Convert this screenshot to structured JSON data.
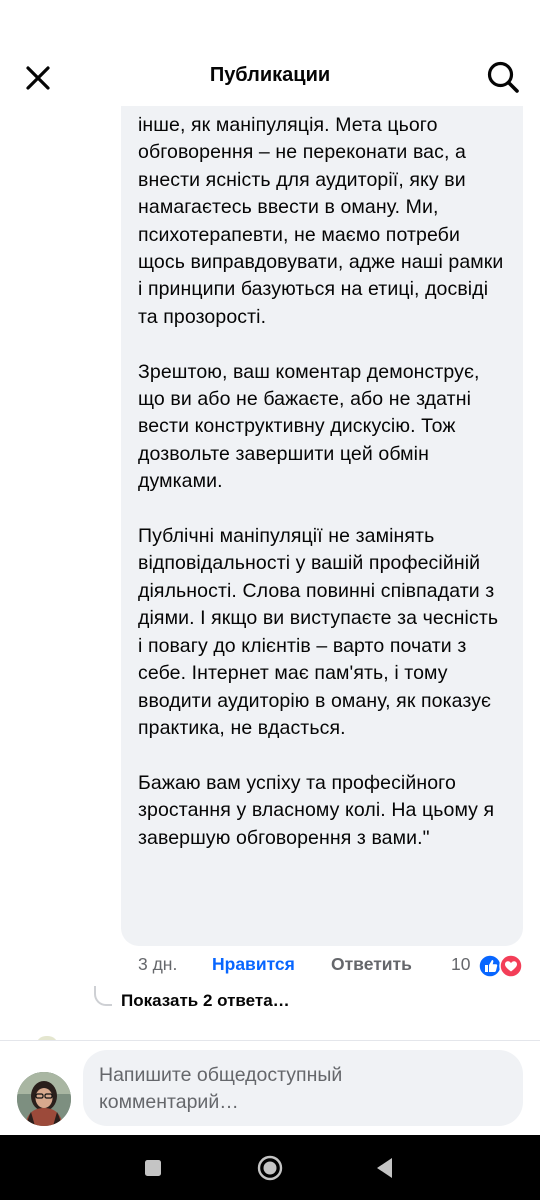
{
  "header": {
    "title": "Публикации",
    "close_icon": "close-icon",
    "search_icon": "search-icon"
  },
  "comment": {
    "top_partial": "….. … … …",
    "paragraphs": [
      "інше, як маніпуляція. Мета цього обговорення – не переконати вас, а внести ясність для аудиторії, яку ви намагаєтесь ввести в оману. Ми, психотерапевти, не маємо потреби щось виправдовувати, адже наші рамки і принципи базуються на етиці, досвіді та прозорості.",
      "Зрештою, ваш коментар демонструє, що ви або не бажаєте, або не здатні вести конструктивну дискусію. Тож дозвольте завершити цей обмін думками.",
      "Публічні маніпуляції не замінять відповідальності у вашій професійній діяльності. Слова повинні співпадати з діями. І якщо ви виступаєте за чесність і повагу до клієнтів – варто почати з себе. Інтернет має пам'ять, і тому вводити аудиторію в оману, як показує практика, не вдасться.",
      "Бажаю вам успіху та професійного зростання у власному колі. На цьому я завершую обговорення з вами.\""
    ],
    "time": "3 дн.",
    "like_label": "Нравится",
    "reply_label": "Ответить",
    "reaction_count": "10",
    "reactions": [
      "like-icon",
      "love-icon"
    ],
    "colors": {
      "like": "#0866ff",
      "love": "#f33e58"
    }
  },
  "replies": {
    "show_label": "Показать 2 ответа…"
  },
  "composer": {
    "placeholder": "Напишите общедоступный\nкомментарий…"
  },
  "navbar": {
    "items": [
      "recents-icon",
      "home-icon",
      "back-icon"
    ]
  }
}
